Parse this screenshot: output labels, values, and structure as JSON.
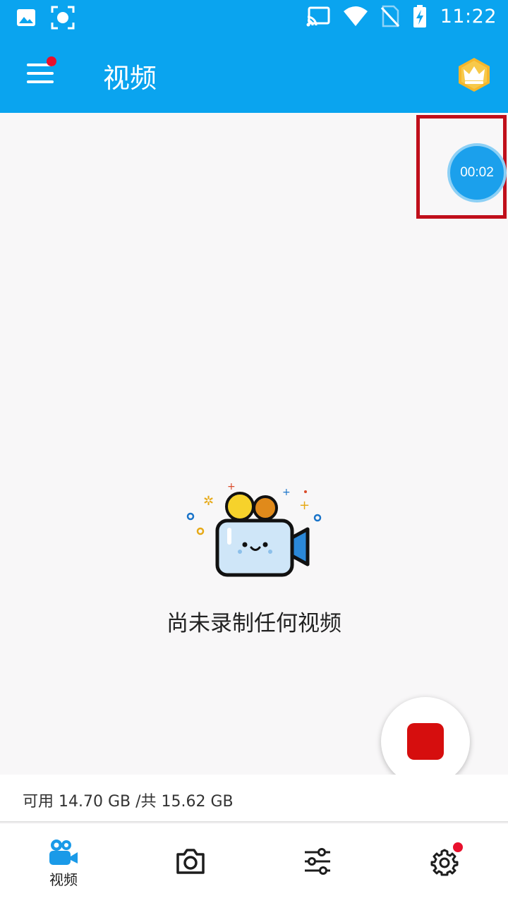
{
  "status_bar": {
    "time": "11:22",
    "icons": [
      "image-icon",
      "screen-record-icon",
      "cast-icon",
      "wifi-icon",
      "no-sim-icon",
      "battery-charging-icon"
    ]
  },
  "app_bar": {
    "title": "视频",
    "menu_icon": "menu-icon",
    "premium_icon": "crown-icon"
  },
  "floating_timer": {
    "time": "00:02"
  },
  "empty_state": {
    "message": "尚未录制任何视频",
    "icon": "video-camera-illustration"
  },
  "record_button": {
    "icon": "stop-icon",
    "state": "recording"
  },
  "storage": {
    "text": "可用 14.70 GB /共 15.62 GB"
  },
  "bottom_nav": {
    "items": [
      {
        "id": "video",
        "label": "视频",
        "icon": "video-camera-icon",
        "active": true
      },
      {
        "id": "screenshot",
        "label": "",
        "icon": "camera-icon",
        "active": false
      },
      {
        "id": "tools",
        "label": "",
        "icon": "sliders-icon",
        "active": false
      },
      {
        "id": "settings",
        "label": "",
        "icon": "gear-icon",
        "active": false,
        "badge": true
      }
    ]
  },
  "colors": {
    "primary": "#0aa4ef",
    "record": "#d60e0e",
    "badge": "#e8102d"
  }
}
